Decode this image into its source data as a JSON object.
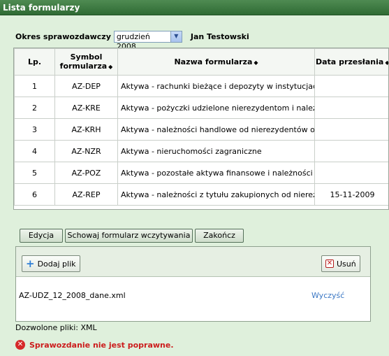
{
  "window": {
    "title": "Lista formularzy"
  },
  "period": {
    "label": "Okres sprawozdawczy",
    "selected": "grudzień 2008",
    "user": "Jan Testowski"
  },
  "table": {
    "headers": {
      "lp": "Lp.",
      "symbol_line1": "Symbol",
      "symbol_line2": "formularza",
      "name": "Nazwa formularza",
      "date": "Data przesłania"
    },
    "rows": [
      {
        "lp": "1",
        "symbol": "AZ-DEP",
        "name": "Aktywa - rachunki bieżące i depozyty w instytucjach kred",
        "date": ""
      },
      {
        "lp": "2",
        "symbol": "AZ-KRE",
        "name": "Aktywa - pożyczki udzielone nierezydentom i należności i",
        "date": ""
      },
      {
        "lp": "3",
        "symbol": "AZ-KRH",
        "name": "Aktywa - należności handlowe od nierezydentów oraz z",
        "date": ""
      },
      {
        "lp": "4",
        "symbol": "AZ-NZR",
        "name": "Aktywa - nieruchomości zagraniczne",
        "date": ""
      },
      {
        "lp": "5",
        "symbol": "AZ-POZ",
        "name": "Aktywa - pozostałe aktywa finansowe i należności od nie",
        "date": ""
      },
      {
        "lp": "6",
        "symbol": "AZ-REP",
        "name": "Aktywa - należności z tytułu zakupionych od nierezydent",
        "date": "15-11-2009"
      }
    ]
  },
  "buttons": {
    "edit": "Edycja",
    "hide": "Schowaj formularz wczytywania",
    "finish": "Zakończ"
  },
  "upload": {
    "add_label": "Dodaj plik",
    "remove_label": "Usuń",
    "file_name": "AZ-UDZ_12_2008_dane.xml",
    "clear_label": "Wyczyść",
    "allowed": "Dozwolone pliki: XML"
  },
  "status": {
    "error": "Sprawozdanie nie jest poprawne."
  },
  "icons": {
    "add": "plus-icon",
    "remove": "x-icon",
    "error": "error-icon",
    "sort": "sort-icon",
    "dropdown": "chevron-down-icon"
  }
}
